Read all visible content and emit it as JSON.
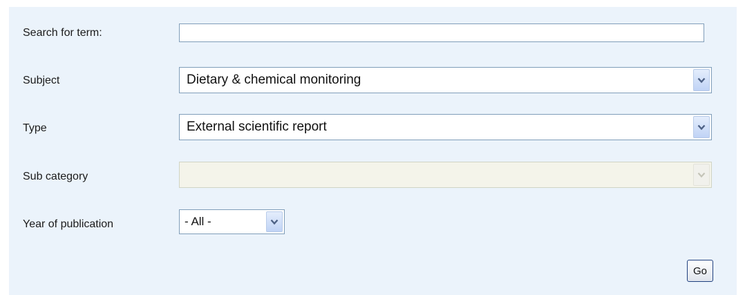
{
  "form": {
    "search": {
      "label": "Search for term:",
      "value": ""
    },
    "subject": {
      "label": "Subject",
      "selected": "Dietary & chemical monitoring"
    },
    "type": {
      "label": "Type",
      "selected": "External scientific report"
    },
    "sub_category": {
      "label": "Sub category",
      "selected": "",
      "disabled": true
    },
    "year": {
      "label": "Year of publication",
      "selected": "- All -"
    },
    "submit_label": "Go"
  },
  "icons": {
    "dropdown": "chevron-down-icon"
  },
  "colors": {
    "panel_background": "#ebf3fb",
    "field_border": "#7f9db9",
    "dropdown_arrow": "#4d6185",
    "disabled_background": "#f4f4ea"
  }
}
